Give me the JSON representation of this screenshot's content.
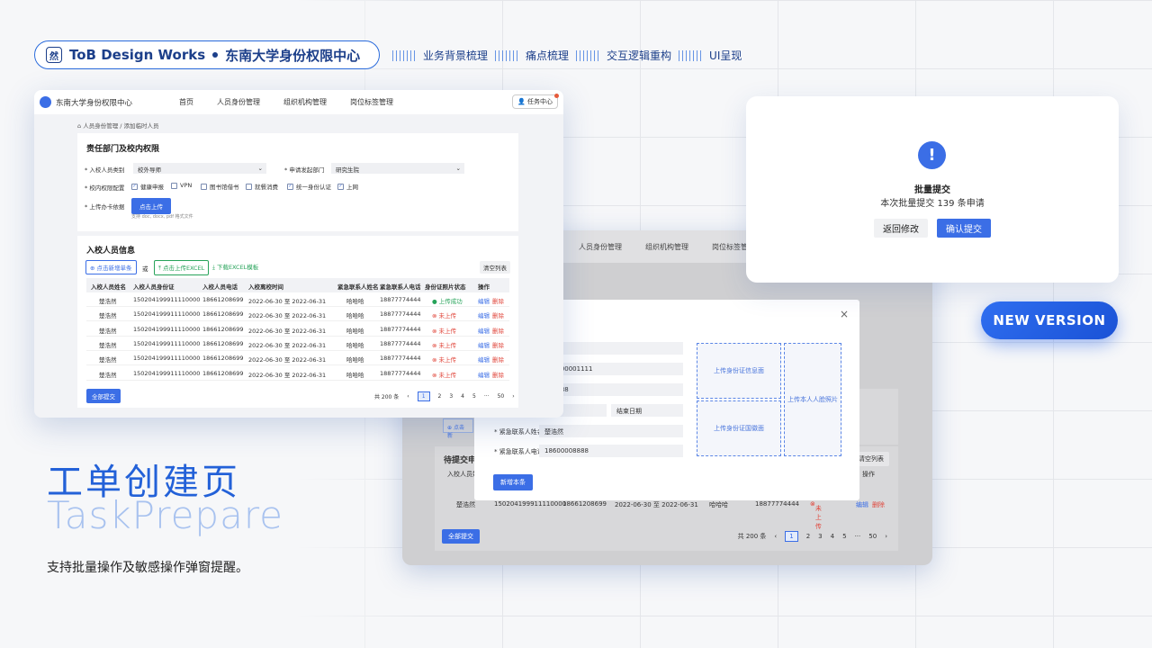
{
  "header": {
    "logo_text": "然",
    "brand": "ToB Design Works",
    "project": "东南大学身份权限中心",
    "steps": [
      "业务背景梳理",
      "痛点梳理",
      "交互逻辑重构",
      "UI呈现"
    ]
  },
  "hero": {
    "title_cn": "工单创建页",
    "title_en": "TaskPrepare",
    "caption": "支持批量操作及敏感操作弹窗提醒。"
  },
  "badge": "NEW VERSION",
  "main_window": {
    "app_name": "东南大学身份权限中心",
    "nav": [
      "首页",
      "人员身份管理",
      "组织机构管理",
      "岗位标签管理"
    ],
    "task_center": "任务中心",
    "breadcrumb": "人员身份管理 / 添加临时人员",
    "section1": {
      "title": "责任部门及校内权限",
      "f1_label": "* 入校人员类别",
      "f1_value": "校外导师",
      "f2_label": "* 申请发起部门",
      "f2_value": "研究生院",
      "perm_label": "* 校内权限配置",
      "perms": [
        {
          "label": "健康申报",
          "checked": true
        },
        {
          "label": "VPN",
          "checked": false
        },
        {
          "label": "图书馆借书",
          "checked": false
        },
        {
          "label": "就餐消费",
          "checked": false
        },
        {
          "label": "统一身份认证",
          "checked": true
        },
        {
          "label": "上网",
          "checked": true
        }
      ],
      "upload_label": "* 上传办卡依据",
      "upload_btn": "点击上传",
      "upload_hint": "支持 doc, docx, pdf 格式文件"
    },
    "section2": {
      "title": "入校人员信息",
      "add_single": "点击新增单条",
      "or": "或",
      "upload_excel": "点击上传EXCEL",
      "download_excel": "下载EXCEL模板",
      "clear": "清空列表",
      "columns": [
        "入校人员姓名",
        "入校人员身份证",
        "入校人员电话",
        "入校离校时间",
        "紧急联系人姓名",
        "紧急联系人电话",
        "身份证照片状态",
        "操作"
      ],
      "rows": [
        {
          "name": "楚浩然",
          "id": "150204199911110000",
          "phone": "18661208699",
          "time": "2022-06-30 至 2022-06-31",
          "contact": "哈哈哈",
          "cphone": "18877774444",
          "status": "上传成功",
          "ok": true
        },
        {
          "name": "楚浩然",
          "id": "150204199911110000",
          "phone": "18661208699",
          "time": "2022-06-30 至 2022-06-31",
          "contact": "哈哈哈",
          "cphone": "18877774444",
          "status": "未上传",
          "ok": false
        },
        {
          "name": "楚浩然",
          "id": "150204199911110000",
          "phone": "18661208699",
          "time": "2022-06-30 至 2022-06-31",
          "contact": "哈哈哈",
          "cphone": "18877774444",
          "status": "未上传",
          "ok": false
        },
        {
          "name": "楚浩然",
          "id": "150204199911110000",
          "phone": "18661208699",
          "time": "2022-06-30 至 2022-06-31",
          "contact": "哈哈哈",
          "cphone": "18877774444",
          "status": "未上传",
          "ok": false
        },
        {
          "name": "楚浩然",
          "id": "150204199911110000",
          "phone": "18661208699",
          "time": "2022-06-30 至 2022-06-31",
          "contact": "哈哈哈",
          "cphone": "18877774444",
          "status": "未上传",
          "ok": false
        },
        {
          "name": "楚浩然",
          "id": "150204199911110000",
          "phone": "18661208699",
          "time": "2022-06-30 至 2022-06-31",
          "contact": "哈哈哈",
          "cphone": "18877774444",
          "status": "未上传",
          "ok": false
        }
      ],
      "edit": "编辑",
      "delete": "删除",
      "submit_all": "全部提交",
      "pager": {
        "total": "共 200 条",
        "pages": [
          "1",
          "2",
          "3",
          "4",
          "5",
          "···",
          "50"
        ],
        "prev": "‹",
        "next": "›"
      }
    }
  },
  "back_window": {
    "nav": [
      "人员身份管理",
      "组织机构管理",
      "岗位标签管理"
    ],
    "pending_title": "待提交申请",
    "clear": "清空列表",
    "op": "操作",
    "add_short": "点击新",
    "col1": "入校人员姓",
    "row_edit": "编辑",
    "row_del": "删除",
    "row": {
      "name": "楚浩然",
      "id": "150204199911110000",
      "phone": "18661208699",
      "time": "2022-06-30 至 2022-06-31",
      "contact": "哈哈哈",
      "cphone": "18877774444",
      "status": "未上传"
    },
    "submit_all": "全部提交",
    "pager": {
      "total": "共 200 条",
      "pages": [
        "1",
        "2",
        "3",
        "4",
        "5",
        "···",
        "50"
      ]
    }
  },
  "modal": {
    "id_value": "199900001111",
    "phone_partial": "008888",
    "date_start": "期",
    "date_end": "结束日期",
    "contact_label": "* 紧急联系人姓名",
    "contact_value": "楚浩然",
    "cphone_label": "* 紧急联系人电话",
    "cphone_value": "18600008888",
    "upload_front": "上传身份证信息面",
    "upload_back": "上传身份证国徽面",
    "upload_face": "上传本人人脸照片",
    "add_btn": "新增本条",
    "close": "×"
  },
  "confirm": {
    "icon": "!",
    "title": "批量提交",
    "message": "本次批量提交 139 条申请",
    "back_btn": "返回修改",
    "ok_btn": "确认提交"
  },
  "colors": {
    "accent": "#3b6ee6",
    "brand_dark": "#1c3f8a",
    "success": "#27a35a",
    "danger": "#e0453a"
  }
}
